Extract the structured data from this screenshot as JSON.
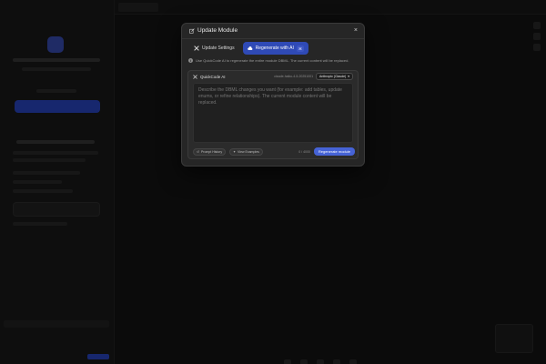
{
  "colors": {
    "accent": "#2f4ab6",
    "button": "#4663d6",
    "modal_bg": "#262626",
    "page_bg": "#141414"
  },
  "modal": {
    "title": "Update Module",
    "title_icon": "edit-icon",
    "close_label": "×",
    "tabs": [
      {
        "label": "Update Settings",
        "icon": "tools-icon",
        "active": false
      },
      {
        "label": "Regenerate with AI",
        "icon": "cloud-icon",
        "active": true,
        "shortcut": "⌘"
      }
    ],
    "info": "Use QuickCode AI to regenerate the entire module DBML. The current content will be replaced.",
    "ai_panel": {
      "label": "QuickCode AI",
      "model_label": "claude-haiku-4-5-20251001",
      "provider": "Anthropic (Claude)",
      "prompt_placeholder": "Describe the DBML changes you want (for example: add tables, update enums, or refine relationships). The current module content will be replaced.",
      "history_label": "Prompt History",
      "examples_label": "View Examples",
      "char_count": "0 / 4000",
      "submit_label": "Regenerate module"
    }
  }
}
